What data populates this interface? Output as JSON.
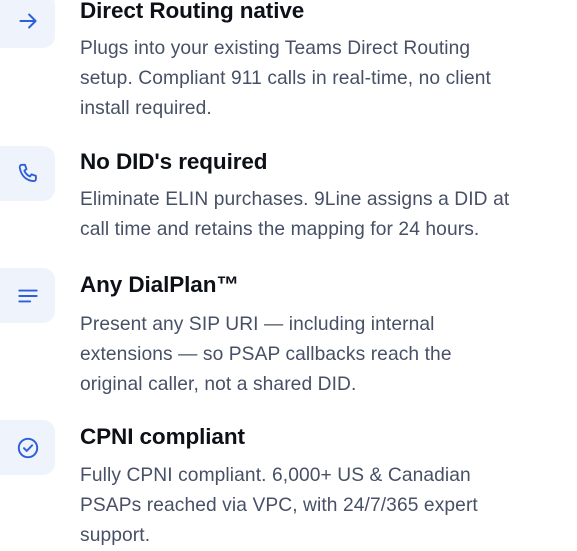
{
  "accent_color": "#2f5fd8",
  "features": [
    {
      "icon": "arrow-right-icon",
      "title": "Direct Routing native",
      "lines": [
        "Plugs into your existing Teams Direct Routing",
        "setup. Compliant 911 calls in real-time, no client",
        "install required."
      ]
    },
    {
      "icon": "phone-icon",
      "title": "No DID's required",
      "lines": [
        "Eliminate ELIN purchases. 9Line assigns a DID at",
        "call time and retains the mapping for 24 hours."
      ]
    },
    {
      "icon": "menu-lines-icon",
      "title": "Any DialPlan™",
      "lines": [
        "Present any SIP URI — including internal",
        "extensions — so PSAP callbacks reach the",
        "original caller, not a shared DID."
      ]
    },
    {
      "icon": "check-circle-icon",
      "title": "CPNI compliant",
      "lines": [
        "Fully CPNI compliant. 6,000+ US & Canadian",
        "PSAPs reached via VPC, with 24/7/365 expert",
        "support."
      ]
    }
  ]
}
